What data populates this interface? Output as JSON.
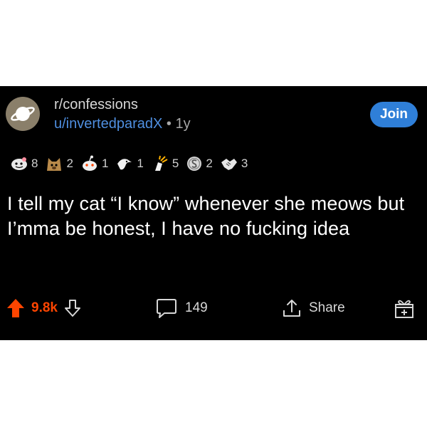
{
  "post": {
    "subreddit": "r/confessions",
    "username": "u/invertedparadX",
    "separator": "•",
    "age": "1y",
    "join_label": "Join",
    "awards": [
      {
        "icon": "wholesome-award-icon",
        "count": "8"
      },
      {
        "icon": "doge-award-icon",
        "count": "2"
      },
      {
        "icon": "snoo-award-icon",
        "count": "1"
      },
      {
        "icon": "helpful-award-icon",
        "count": "1"
      },
      {
        "icon": "bravo-award-icon",
        "count": "5"
      },
      {
        "icon": "silver-coin-award-icon",
        "count": "2"
      },
      {
        "icon": "handshake-award-icon",
        "count": "3"
      }
    ],
    "body": "I tell my cat “I know” whenever she meows but I’mma be honest, I have no fucking idea",
    "score": "9.8k",
    "comments": "149",
    "share_label": "Share"
  },
  "colors": {
    "background": "#000000",
    "upvote": "#ff4500",
    "username": "#4f8fe0",
    "join_button": "#2f7fd8"
  }
}
